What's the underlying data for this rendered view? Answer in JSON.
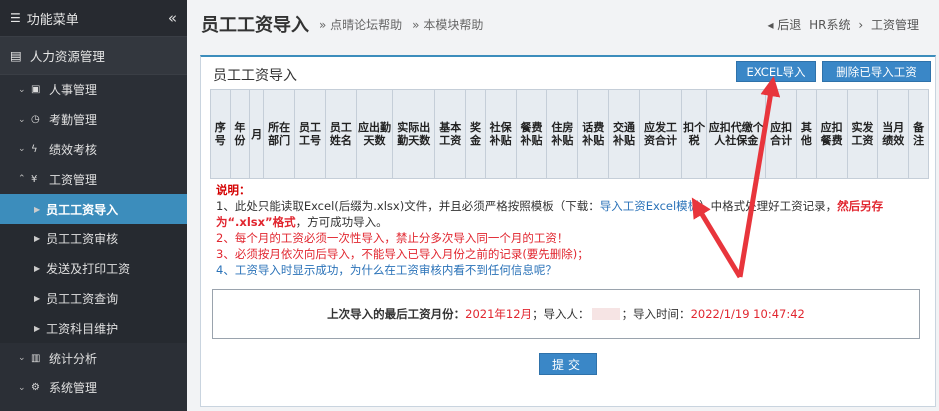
{
  "sidebar": {
    "header": "功能菜单",
    "collapse": "«",
    "section": "人力资源管理",
    "items": [
      {
        "label": "人事管理",
        "chev": "⌄",
        "icon": "▣"
      },
      {
        "label": "考勤管理",
        "chev": "⌄",
        "icon": "◷"
      },
      {
        "label": "绩效考核",
        "chev": "⌄",
        "icon": "ϟ"
      },
      {
        "label": "工资管理",
        "chev": "⌃",
        "icon": "¥"
      }
    ],
    "sub_items": [
      "员工工资导入",
      "员工工资审核",
      "发送及打印工资",
      "员工工资查询",
      "工资科目维护"
    ],
    "bottom_items": [
      {
        "label": "统计分析",
        "chev": "⌄",
        "icon": "▥"
      },
      {
        "label": "系统管理",
        "chev": "⌄",
        "icon": "⚙"
      }
    ]
  },
  "header": {
    "title": "员工工资导入",
    "help1": "» 点晴论坛帮助",
    "help2": "» 本模块帮助",
    "back": "◂ 后退",
    "crumb1": "HR系统",
    "sep": "›",
    "crumb2": "工资管理"
  },
  "panel": {
    "title": "员工工资导入",
    "excel_button": "EXCEL导入",
    "delete_button": "删除已导入工资"
  },
  "table_headers": [
    "序号",
    "年份",
    "月",
    "所在部门",
    "员工工号",
    "员工姓名",
    "应出勤天数",
    "实际出勤天数",
    "基本工资",
    "奖金",
    "社保补贴",
    "餐费补贴",
    "住房补贴",
    "话费补贴",
    "交通补贴",
    "应发工资合计",
    "扣个税",
    "应扣代缴个人社保金",
    "应扣合计",
    "其他",
    "应扣餐费",
    "实发工资",
    "当月绩效",
    "备注"
  ],
  "notes": {
    "label": "说明：",
    "n1a": "1、此处只能读取Excel(后缀为.xlsx)文件，并且必须严格按照模板（下载：",
    "n1link": "导入工资Excel模板",
    "n1b": "）中格式处理好工资记录，",
    "n1c": "然后另存为“.xlsx”格式",
    "n1d": "，方可成功导入。",
    "n2": "2、每个月的工资必须一次性导入，禁止分多次导入同一个月的工资！",
    "n3": "3、必须按月依次向后导入，不能导入已导入月份之前的记录(要先删除)；",
    "n4": "4、工资导入时显示成功，为什么在工资审核内看不到任何信息呢？"
  },
  "info": {
    "k1": "上次导入的最后工资月份：",
    "v1": "2021年12月",
    "k2": "；导入人：",
    "k3": "；导入时间：",
    "v3": "2022/1/19 10:47:42"
  },
  "submit": "提交",
  "colors": {
    "accent": "#3a87c7",
    "sidebar": "#2b2f36",
    "active": "#3c8dbc",
    "warn": "#e1262f",
    "arrow": "#e8353c"
  }
}
